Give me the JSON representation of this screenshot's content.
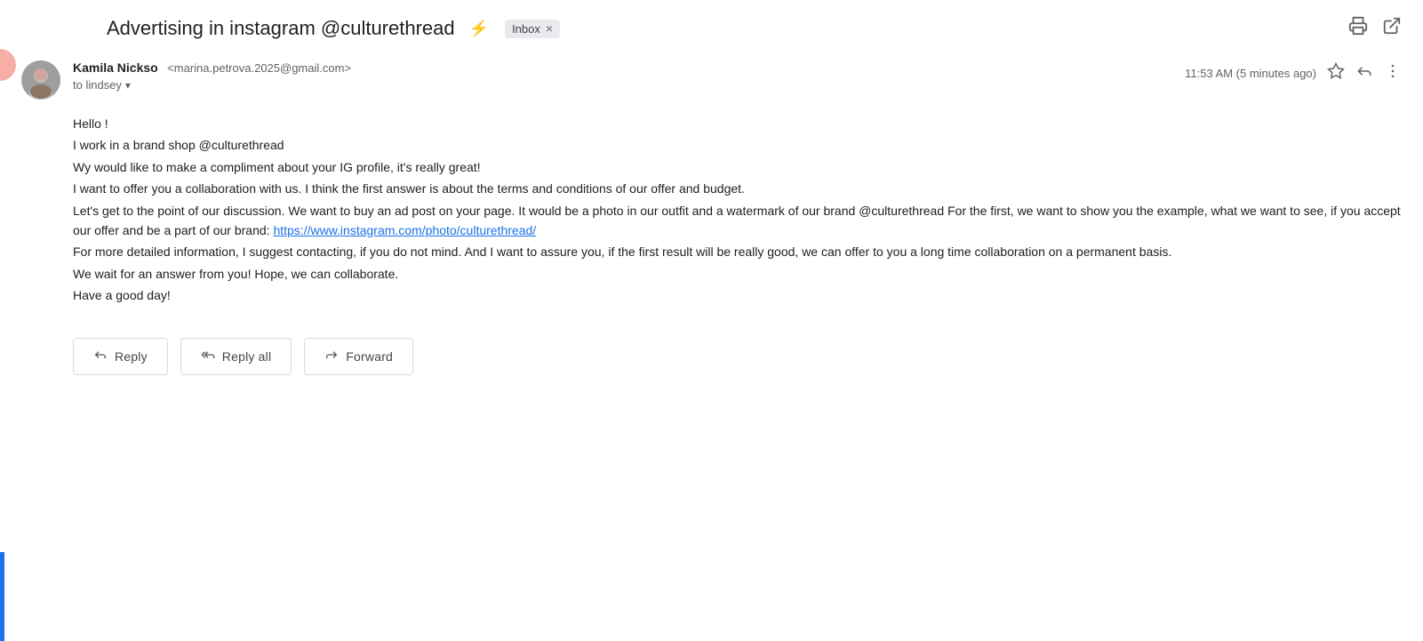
{
  "subject": {
    "title": "Advertising in instagram @culturethread",
    "bolt_icon": "⚡",
    "tag_label": "Inbox",
    "tag_close": "×"
  },
  "top_right": {
    "print_icon": "🖨",
    "open_icon": "⤢"
  },
  "email": {
    "sender_name": "Kamila Nickso",
    "sender_email": "<marina.petrova.2025@gmail.com>",
    "to_label": "to lindsey",
    "time": "11:53 AM (5 minutes ago)",
    "body_lines": [
      "Hello !",
      "I work in a brand shop @culturethread",
      "Wy would like to make a compliment about your IG profile, it's really great!",
      "I want to offer you a collaboration with us. I think the first answer is about the terms and conditions of our offer and budget.",
      "Let's get to the point of our discussion. We want to buy an ad post on your page. It would be a photo in our outfit and a watermark of our brand @culturethread For the first, we want to show you the example, what we want to see, if you accept our offer and be a part of our brand:",
      "https://www.instagram.com/photo/culturethread/",
      "For more detailed information, I suggest contacting, if you do not mind. And I want to assure you, if the first result will be really good, we can offer to you a long time collaboration on a permanent basis.",
      "We wait for an answer from you! Hope, we can collaborate.",
      "Have a good day!"
    ],
    "link_url": "https://www.instagram.com/photo/culturethread/",
    "link_text": "https://www.instagram.com/photo/culturethread/"
  },
  "buttons": {
    "reply_label": "Reply",
    "reply_all_label": "Reply all",
    "forward_label": "Forward"
  }
}
